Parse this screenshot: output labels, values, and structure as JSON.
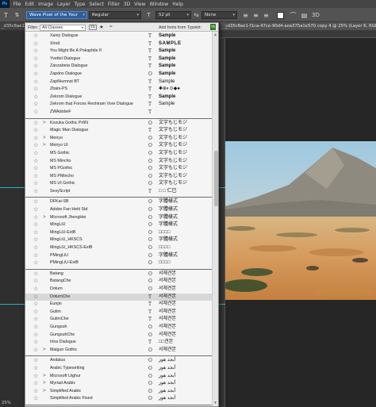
{
  "menubar": {
    "logo": "Ps",
    "items": [
      "File",
      "Edit",
      "Image",
      "Layer",
      "Type",
      "Select",
      "Filter",
      "3D",
      "View",
      "Window",
      "Help"
    ]
  },
  "options": {
    "font_family": "Wave Pixel of the Your",
    "font_style": "Regular",
    "font_size": "52 pt",
    "antialias": "None"
  },
  "tabs": {
    "left_tab": "_d35c8ae1-f",
    "right_tab": "_d35c8ae1-f1ca-47ce-90d4-aea375a1e570 copy 4 @ 25% (Layer 6, RGB/8#)",
    "close": "×"
  },
  "font_panel": {
    "filter_label": "Filter:",
    "filter_value": "All Classes",
    "typekit_label": "Add fonts from Typekit:",
    "typekit_icon": "Tk",
    "groups": [
      [
        {
          "name": "Xaniy Dialogue",
          "type": "T",
          "sample": "Sample",
          "style": "bold",
          "chev": ""
        },
        {
          "name": "Xirod",
          "type": "T",
          "sample": "SAMPLE",
          "style": "wide",
          "chev": ""
        },
        {
          "name": "You Might Be A Pokaphile If",
          "type": "T",
          "sample": "Sample",
          "style": "bold",
          "chev": ""
        },
        {
          "name": "Yvettel Dialogue",
          "type": "T",
          "sample": "Sample",
          "style": "bold",
          "chev": ""
        },
        {
          "name": "Zanzabeta Dialogue",
          "type": "T",
          "sample": "Sample",
          "style": "bold",
          "chev": ""
        },
        {
          "name": "Zapdos Dialogue",
          "type": "O",
          "sample": "Sample",
          "style": "bold",
          "chev": ""
        },
        {
          "name": "ZapfHumnst BT",
          "type": "T",
          "sample": "Sample",
          "style": "",
          "chev": ""
        },
        {
          "name": "Zbats-PS",
          "type": "T",
          "sample": "✱⊕◐⊙◆●",
          "style": "",
          "chev": ""
        },
        {
          "name": "Zekrom Dialogue",
          "type": "T",
          "sample": "Sample",
          "style": "bold",
          "chev": ""
        },
        {
          "name": "Zekrom that Forces Reshiram Vore Dialogue",
          "type": "T",
          "sample": "Sample",
          "style": "",
          "chev": ""
        },
        {
          "name": "ZWAdobeF",
          "type": "T",
          "sample": "",
          "style": "",
          "chev": ""
        }
      ],
      [
        {
          "name": "Kozuka Gothic Pr6N",
          "type": "O",
          "sample": "文字もじモジ",
          "style": "",
          "chev": ">"
        },
        {
          "name": "Magic Man Dialogue",
          "type": "T",
          "sample": "文字もじモジ",
          "style": "",
          "chev": ""
        },
        {
          "name": "Meiryo",
          "type": "O",
          "sample": "文字もじモジ",
          "style": "",
          "chev": ">"
        },
        {
          "name": "Meiryo UI",
          "type": "O",
          "sample": "文字もじモジ",
          "style": "",
          "chev": ">"
        },
        {
          "name": "MS Gothic",
          "type": "O",
          "sample": "文字もじモジ",
          "style": "",
          "chev": ""
        },
        {
          "name": "MS Mincho",
          "type": "O",
          "sample": "文字もじモジ",
          "style": "",
          "chev": ""
        },
        {
          "name": "MS PGothic",
          "type": "O",
          "sample": "文字もじモジ",
          "style": "",
          "chev": ""
        },
        {
          "name": "MS PMincho",
          "type": "O",
          "sample": "文字もじモジ",
          "style": "",
          "chev": ""
        },
        {
          "name": "MS UI Gothic",
          "type": "O",
          "sample": "文字もじモジ",
          "style": "",
          "chev": ""
        },
        {
          "name": "SexyScript",
          "type": "T",
          "sample": "□ □ 仁巳",
          "style": "",
          "chev": ""
        }
      ],
      [
        {
          "name": "DFKai-SB",
          "type": "O",
          "sample": "字體樣式",
          "style": "",
          "chev": ""
        },
        {
          "name": "Adobe Fan Heiti Std",
          "type": "O",
          "sample": "字體樣式",
          "style": "",
          "chev": ""
        },
        {
          "name": "Microsoft JhengHei",
          "type": "O",
          "sample": "字體樣式",
          "style": "",
          "chev": ">"
        },
        {
          "name": "MingLiU",
          "type": "O",
          "sample": "字體樣式",
          "style": "",
          "chev": ""
        },
        {
          "name": "MingLiU-ExtB",
          "type": "O",
          "sample": "□□□□",
          "style": "",
          "chev": ""
        },
        {
          "name": "MingLiU_HKSCS",
          "type": "O",
          "sample": "字體樣式",
          "style": "",
          "chev": ""
        },
        {
          "name": "MingLiU_HKSCS-ExtB",
          "type": "O",
          "sample": "□□□□",
          "style": "",
          "chev": ""
        },
        {
          "name": "PMingLiU",
          "type": "O",
          "sample": "字體樣式",
          "style": "",
          "chev": ""
        },
        {
          "name": "PMingLiU-ExtB",
          "type": "O",
          "sample": "□□□□",
          "style": "",
          "chev": ""
        }
      ],
      [
        {
          "name": "Batang",
          "type": "O",
          "sample": "서체견본",
          "style": "",
          "chev": ""
        },
        {
          "name": "BatangChe",
          "type": "O",
          "sample": "서체견본",
          "style": "",
          "chev": ""
        },
        {
          "name": "Dotum",
          "type": "O",
          "sample": "서체견본",
          "style": "",
          "chev": ""
        },
        {
          "name": "DotumChe",
          "type": "T",
          "sample": "서체견본",
          "style": "",
          "chev": "",
          "highlight": true
        },
        {
          "name": "Eunjin",
          "type": "T",
          "sample": "서체견본",
          "style": "",
          "chev": ""
        },
        {
          "name": "Gulim",
          "type": "T",
          "sample": "서체견본",
          "style": "",
          "chev": ""
        },
        {
          "name": "GulimChe",
          "type": "T",
          "sample": "서체견본",
          "style": "",
          "chev": ""
        },
        {
          "name": "Gungsuh",
          "type": "O",
          "sample": "서체견본",
          "style": "",
          "chev": ""
        },
        {
          "name": "GungsuhChe",
          "type": "O",
          "sample": "서체견본",
          "style": "",
          "chev": ""
        },
        {
          "name": "Irina Dialogue",
          "type": "T",
          "sample": "□□견본",
          "style": "",
          "chev": ""
        },
        {
          "name": "Malgun Gothic",
          "type": "O",
          "sample": "서체견본",
          "style": "",
          "chev": ">"
        }
      ],
      [
        {
          "name": "Andalus",
          "type": "O",
          "sample": "أبجد هوز",
          "style": "",
          "chev": ""
        },
        {
          "name": "Arabic Typesetting",
          "type": "O",
          "sample": "أبجد هوز",
          "style": "",
          "chev": ""
        },
        {
          "name": "Microsoft Uighur",
          "type": "O",
          "sample": "أبجد هوز",
          "style": "",
          "chev": ">"
        },
        {
          "name": "Myriad Arabic",
          "type": "O",
          "sample": "أبجد هوز",
          "style": "",
          "chev": ">"
        },
        {
          "name": "Simplified Arabic",
          "type": "O",
          "sample": "أبجد هوز",
          "style": "",
          "chev": ">"
        },
        {
          "name": "Simplified Arabic Fixed",
          "type": "O",
          "sample": "أبجد هوز",
          "style": "",
          "chev": ""
        }
      ]
    ]
  },
  "status": {
    "zoom": "25%"
  }
}
